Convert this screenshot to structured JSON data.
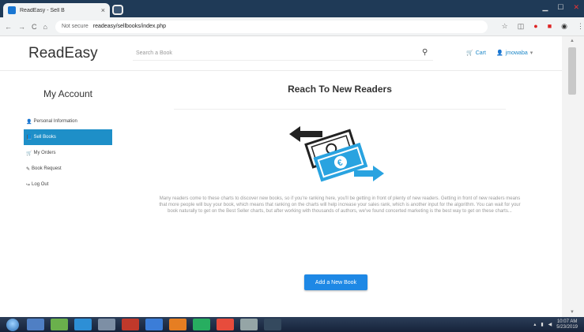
{
  "browser": {
    "tab_title": "ReadEasy - Sell B",
    "tab_close": "×",
    "secure_label": "Not secure",
    "url": "readeasy/sellbooks/index.php",
    "nav_back": "←",
    "nav_forward": "→",
    "nav_reload": "C",
    "nav_home": "⌂"
  },
  "header": {
    "logo": "ReadEasy",
    "search_placeholder": "Search a Book",
    "cart_label": "Cart",
    "user_label": "jmowaba"
  },
  "sidebar": {
    "title": "My Account",
    "items": [
      {
        "label": "Personal Information",
        "active": false,
        "icon": "user-icon"
      },
      {
        "label": "Sell Books",
        "active": true,
        "icon": "book-icon"
      },
      {
        "label": "My Orders",
        "active": false,
        "icon": "cart-icon"
      },
      {
        "label": "Book Request",
        "active": false,
        "icon": "pencil-icon"
      },
      {
        "label": "Log Out",
        "active": false,
        "icon": "logout-icon"
      }
    ]
  },
  "main": {
    "title": "Reach To New Readers",
    "description": "Many readers come to these charts to discover new books, so if you're ranking here, you'll be getting in front of plenty of new readers. Getting in front of new readers means that more people will buy your book, which means that ranking on the charts will help increase your sales rank, which is another input for the algorithm. You can wait for your book naturally to get on the Best Seller charts, but after working with thousands of authors, we've found concerted marketing is the best way to get on these charts...",
    "add_button": "Add a New Book"
  },
  "taskbar": {
    "time": "10:07 AM",
    "date": "5/23/2019"
  },
  "colors": {
    "accent": "#1e88e5",
    "sidebar_active": "#1e8fc8",
    "money_blue": "#29a3e0"
  }
}
